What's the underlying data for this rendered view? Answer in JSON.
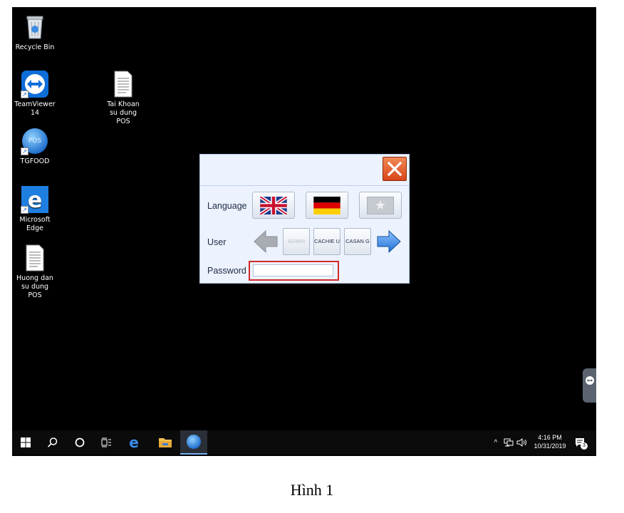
{
  "desktop_icons": [
    {
      "label": "Recycle Bin",
      "icon": "recycle-bin-icon"
    },
    {
      "label": "TeamViewer 14",
      "icon": "teamviewer-icon"
    },
    {
      "label": "TGFOOD",
      "icon": "tgfood-pos-icon",
      "logo_text": "POS"
    },
    {
      "label": "Microsoft Edge",
      "icon": "edge-icon"
    },
    {
      "label": "Huong dan su dung POS",
      "icon": "text-document-icon"
    },
    {
      "label": "Tai Khoan su dung POS",
      "icon": "text-document-icon"
    }
  ],
  "login_dialog": {
    "language_label": "Language",
    "user_label": "User",
    "password_label": "Password",
    "password_value": "",
    "languages": [
      "english-flag",
      "german-flag",
      "star-placeholder"
    ],
    "users": [
      {
        "label": "ADMIN",
        "enabled": false
      },
      {
        "label": "CACHIE U",
        "enabled": true
      },
      {
        "label": "CASAN G",
        "enabled": true
      }
    ],
    "highlight_color": "#d22a2a",
    "close_color": "#e1531f"
  },
  "taskbar": {
    "time": "4:16 PM",
    "date": "10/31/2019",
    "notification_count": "3"
  },
  "caption": "Hình 1"
}
